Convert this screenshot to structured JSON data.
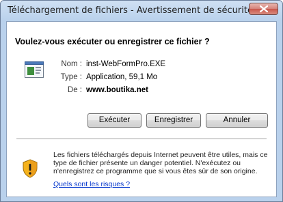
{
  "window": {
    "title": "Téléchargement de fichiers - Avertissement de sécurité"
  },
  "dialog": {
    "question": "Voulez-vous exécuter ou enregistrer ce fichier ?",
    "file": {
      "name_label": "Nom :",
      "name_value": "inst-WebFormPro.EXE",
      "type_label": "Type :",
      "type_value": "Application, 59,1 Mo",
      "from_label": "De :",
      "from_value": "www.boutika.net"
    },
    "buttons": {
      "run": "Exécuter",
      "save": "Enregistrer",
      "cancel": "Annuler"
    },
    "warning": {
      "text": "Les fichiers téléchargés depuis Internet peuvent être utiles, mais ce type de fichier présente un danger potentiel. N'exécutez ou n'enregistrez ce programme que si vous êtes sûr de son origine.",
      "link": "Quels sont les risques ?"
    }
  },
  "icons": {
    "close": "close-icon",
    "file": "application-file-icon",
    "warning": "security-shield-icon"
  }
}
